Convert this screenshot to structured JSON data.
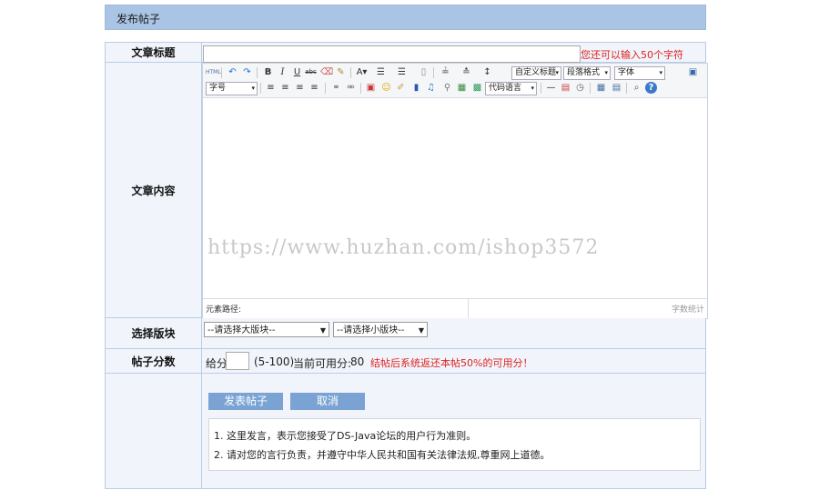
{
  "page": {
    "header_title": "发布帖子"
  },
  "form": {
    "title_label": "文章标题",
    "title_value": "",
    "title_remaining": "您还可以输入50个字符",
    "content_label": "文章内容",
    "board_label": "选择版块",
    "score_label": "帖子分数"
  },
  "editor": {
    "selects": {
      "custom_title": "自定义标题",
      "paragraph": "段落格式",
      "font_family": "字体",
      "font_size": "字号",
      "code_lang": "代码语言"
    },
    "watermark": "https://www.huzhan.com/ishop3572",
    "path_label": "元素路径:",
    "word_count": "字数统计"
  },
  "board": {
    "major_placeholder": "--请选择大版块--",
    "minor_placeholder": "--请选择小版块--"
  },
  "score": {
    "prefix": "给分",
    "value": "",
    "range": "(5-100)",
    "available_label": "当前可用分:",
    "available_value": "80",
    "notice": "结帖后系统返还本帖50%的可用分！"
  },
  "actions": {
    "submit_label": "发表帖子",
    "cancel_label": "取消"
  },
  "notes": [
    "1. 这里发言，表示您接受了DS-Java论坛的用户行为准则。",
    "2. 请对您的言行负责，并遵守中华人民共和国有关法律法规,尊重网上道德。"
  ],
  "colors": {
    "header_bg": "#a9c4e4",
    "button_bg": "#7aa3d4",
    "notice": "#dd2222"
  }
}
